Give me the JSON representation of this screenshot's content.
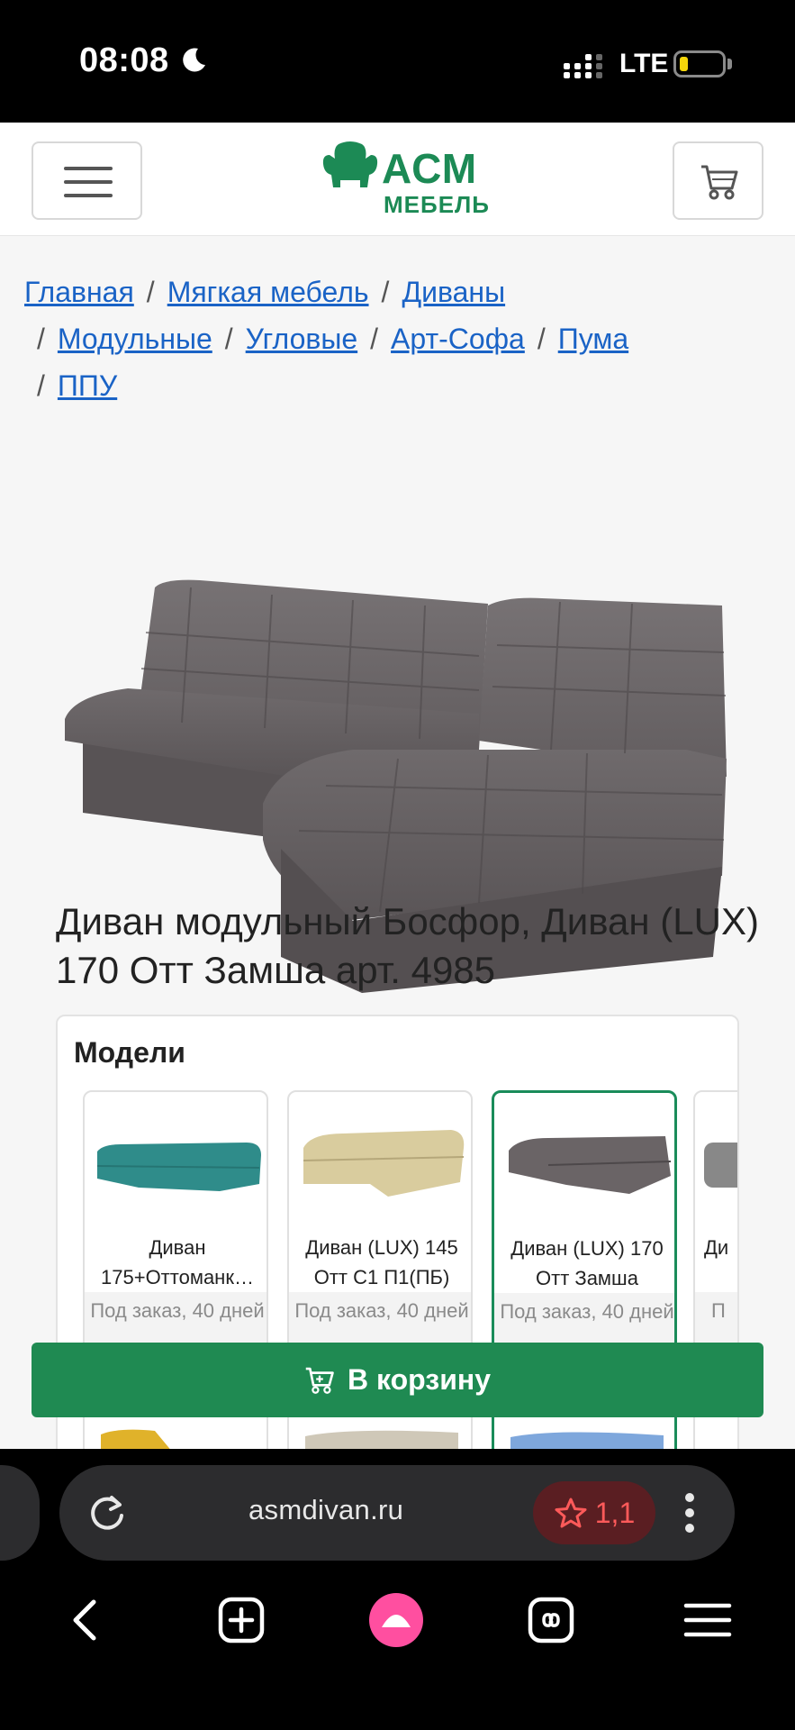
{
  "status_bar": {
    "time": "08:08",
    "network": "LTE",
    "battery_level": 0.2
  },
  "header": {
    "logo_top": "АСМ",
    "logo_bottom": "МЕБЕЛЬ",
    "brand_color": "#1c8a55"
  },
  "breadcrumb": [
    "Главная",
    "Мягкая мебель",
    "Диваны",
    "Модульные",
    "Угловые",
    "Арт-Софа",
    "Пума",
    "ППУ"
  ],
  "product": {
    "title": "Диван модульный Босфор, Диван (LUX) 170 Отт Замша арт. 4985"
  },
  "models": {
    "heading": "Модели",
    "items": [
      {
        "name": "Диван 175+Оттоманк…",
        "availability": "Под заказ, 40 дней",
        "color": "#2f8c8a"
      },
      {
        "name": "Диван (LUX) 145 Отт С1 П1(ПБ)",
        "availability": "Под заказ, 40 дней",
        "color": "#d9cc9e"
      },
      {
        "name": "Диван (LUX) 170 Отт Замша",
        "availability": "Под заказ, 40 дней",
        "color": "#6a6466"
      },
      {
        "name": "Ди",
        "availability": "П",
        "color": "#888"
      }
    ]
  },
  "buy_button": {
    "label": "В корзину",
    "color": "#1f8a52"
  },
  "browser": {
    "url": "asmdivan.ru",
    "rating": "1,1"
  }
}
